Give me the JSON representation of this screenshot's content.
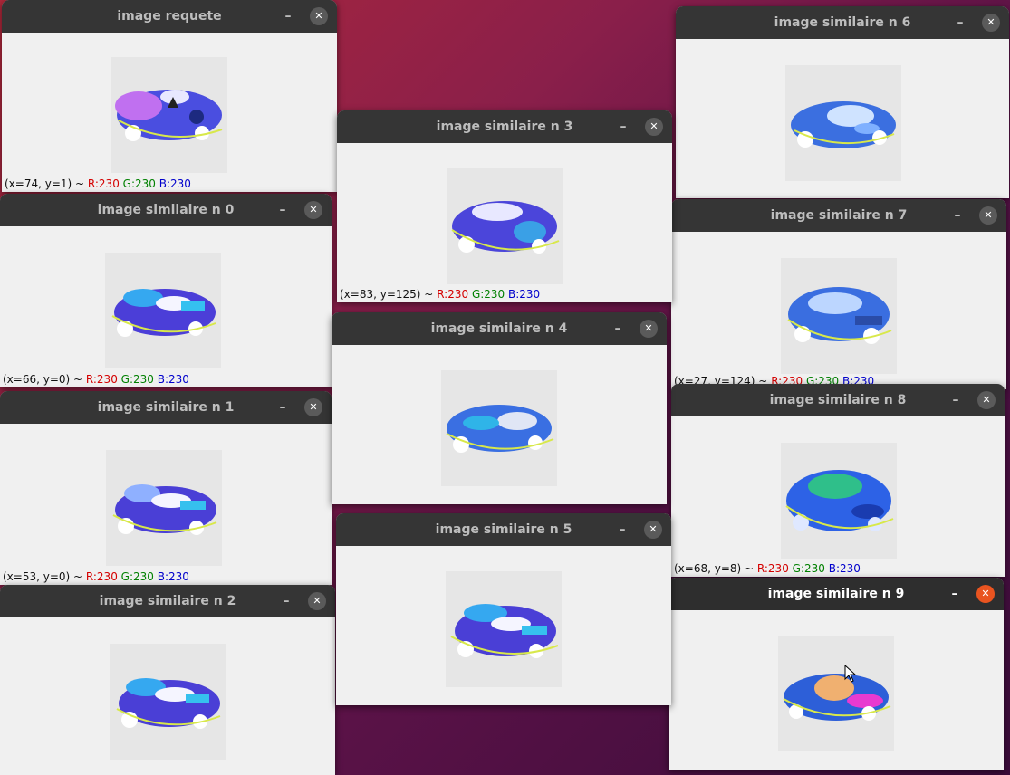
{
  "windows": {
    "query": {
      "title": "image requete",
      "status": {
        "coords": "(x=74, y=1) ~",
        "r": "R:230",
        "g": "G:230",
        "b": "B:230"
      }
    },
    "s0": {
      "title": "image similaire n 0",
      "status": {
        "coords": "(x=66, y=0) ~",
        "r": "R:230",
        "g": "G:230",
        "b": "B:230"
      }
    },
    "s1": {
      "title": "image similaire n 1",
      "status": {
        "coords": "(x=53, y=0) ~",
        "r": "R:230",
        "g": "G:230",
        "b": "B:230"
      }
    },
    "s2": {
      "title": "image similaire n 2"
    },
    "s3": {
      "title": "image similaire n 3",
      "status": {
        "coords": "(x=83, y=125) ~",
        "r": "R:230",
        "g": "G:230",
        "b": "B:230"
      }
    },
    "s4": {
      "title": "image similaire n 4"
    },
    "s5": {
      "title": "image similaire n 5"
    },
    "s6": {
      "title": "image similaire n 6"
    },
    "s7": {
      "title": "image similaire n 7",
      "status": {
        "coords": "(x=27, y=124) ~",
        "r": "R:230",
        "g": "G:230",
        "b": "B:230"
      }
    },
    "s8": {
      "title": "image similaire n 8",
      "status": {
        "coords": "(x=68, y=8) ~",
        "r": "R:230",
        "g": "G:230",
        "b": "B:230"
      }
    },
    "s9": {
      "title": "image similaire n 9"
    }
  },
  "controls": {
    "minimize": "–",
    "close": "✕"
  },
  "colors": {
    "titlebar": "#353535",
    "active_close": "#e95420",
    "content_bg": "#f0f0f0"
  }
}
